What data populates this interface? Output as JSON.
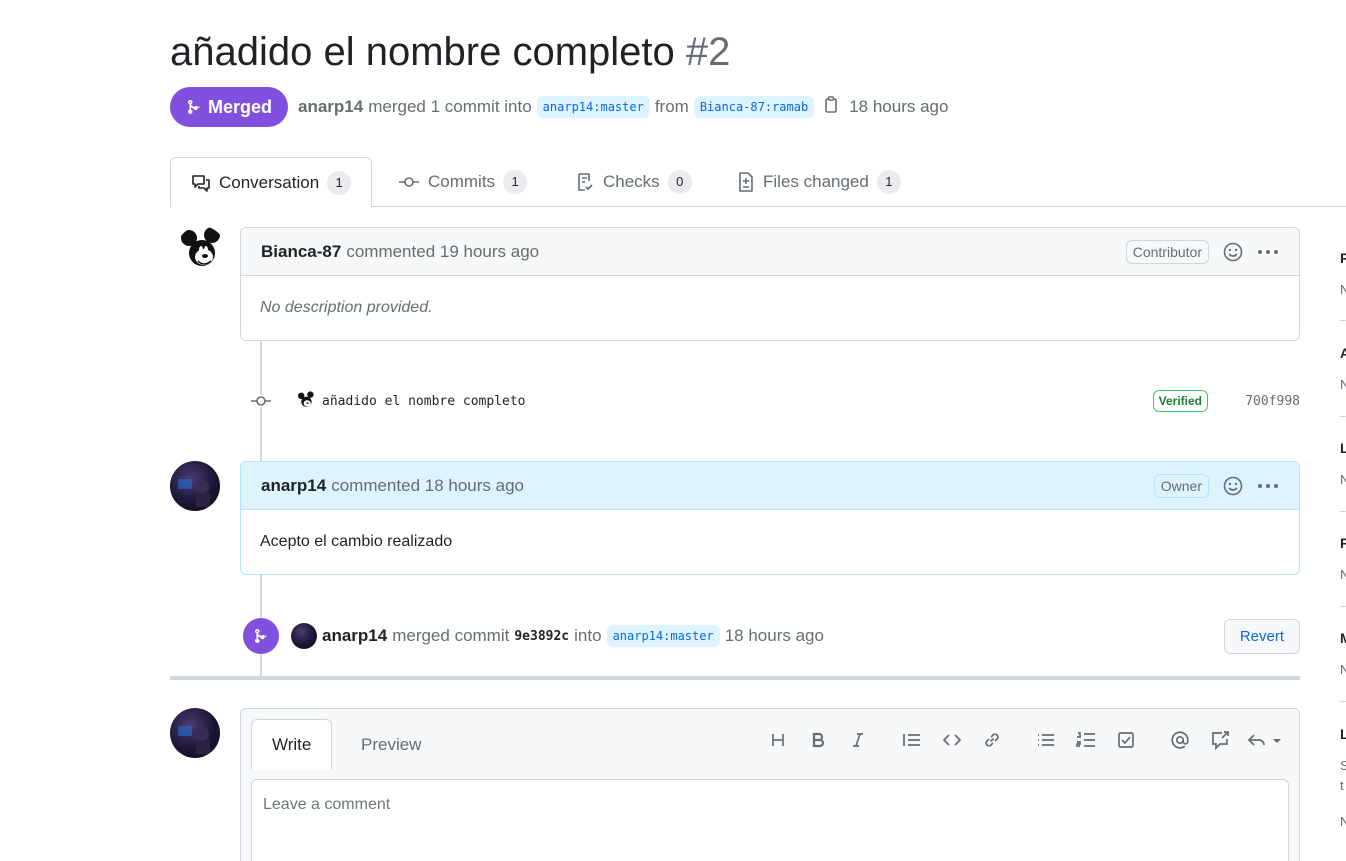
{
  "pr": {
    "title": "añadido el nombre completo",
    "number": "#2",
    "state_label": "Merged",
    "merged_by": "anarp14",
    "merge_text": "merged 1 commit into",
    "base_branch": "anarp14:master",
    "from_text": "from",
    "head_branch": "Bianca-87:ramab",
    "time": "18 hours ago"
  },
  "tabs": [
    {
      "label": "Conversation",
      "count": "1",
      "icon": "comment-discussion-icon"
    },
    {
      "label": "Commits",
      "count": "1",
      "icon": "git-commit-icon"
    },
    {
      "label": "Checks",
      "count": "0",
      "icon": "checklist-icon"
    },
    {
      "label": "Files changed",
      "count": "1",
      "icon": "file-diff-icon"
    }
  ],
  "comments": [
    {
      "author": "Bianca-87",
      "action": "commented 19 hours ago",
      "role": "Contributor",
      "body": "No description provided.",
      "avatar": "mickey-avatar"
    },
    {
      "author": "anarp14",
      "action": "commented 18 hours ago",
      "role": "Owner",
      "body": "Acepto el cambio realizado",
      "avatar": "anarp14-avatar"
    }
  ],
  "commit": {
    "message": "añadido el nombre completo",
    "verified": "Verified",
    "sha": "700f998"
  },
  "merge_event": {
    "author": "anarp14",
    "text_1": "merged commit",
    "sha": "9e3892c",
    "text_2": "into",
    "branch": "anarp14:master",
    "time": "18 hours ago",
    "revert_label": "Revert"
  },
  "editor": {
    "write_tab": "Write",
    "preview_tab": "Preview",
    "placeholder": "Leave a comment",
    "toolbar": [
      "heading-icon",
      "bold-icon",
      "italic-icon",
      "quote-icon",
      "code-icon",
      "link-icon",
      "unordered-list-icon",
      "ordered-list-icon",
      "task-list-icon",
      "mention-icon",
      "cross-reference-icon",
      "reply-icon"
    ]
  },
  "sidebar_fragment": {
    "letters": [
      "R",
      "A",
      "L",
      "P",
      "M",
      "L"
    ],
    "subs": [
      "N",
      "N",
      "N",
      "N",
      "N",
      "S",
      "t",
      "N"
    ]
  },
  "colors": {
    "merged": "#8250df",
    "link": "#0969da",
    "verified": "#1a7f37",
    "owner_header": "#ddf4ff"
  }
}
